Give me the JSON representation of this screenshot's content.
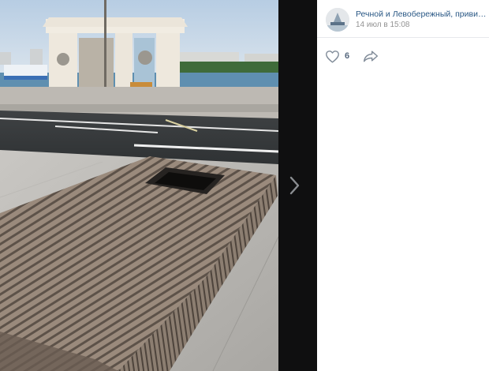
{
  "post": {
    "group_name": "Речной и Левобережный, привива...",
    "date": "14 июл в 15:08",
    "likes_count": "6"
  },
  "icons": {
    "like": "heart-icon",
    "share": "share-arrow-icon",
    "next": "chevron-right-icon",
    "avatar": "group-avatar"
  },
  "colors": {
    "link": "#2a5885",
    "muted": "#939393",
    "counter": "#55677d",
    "viewer_bg": "#000000"
  }
}
